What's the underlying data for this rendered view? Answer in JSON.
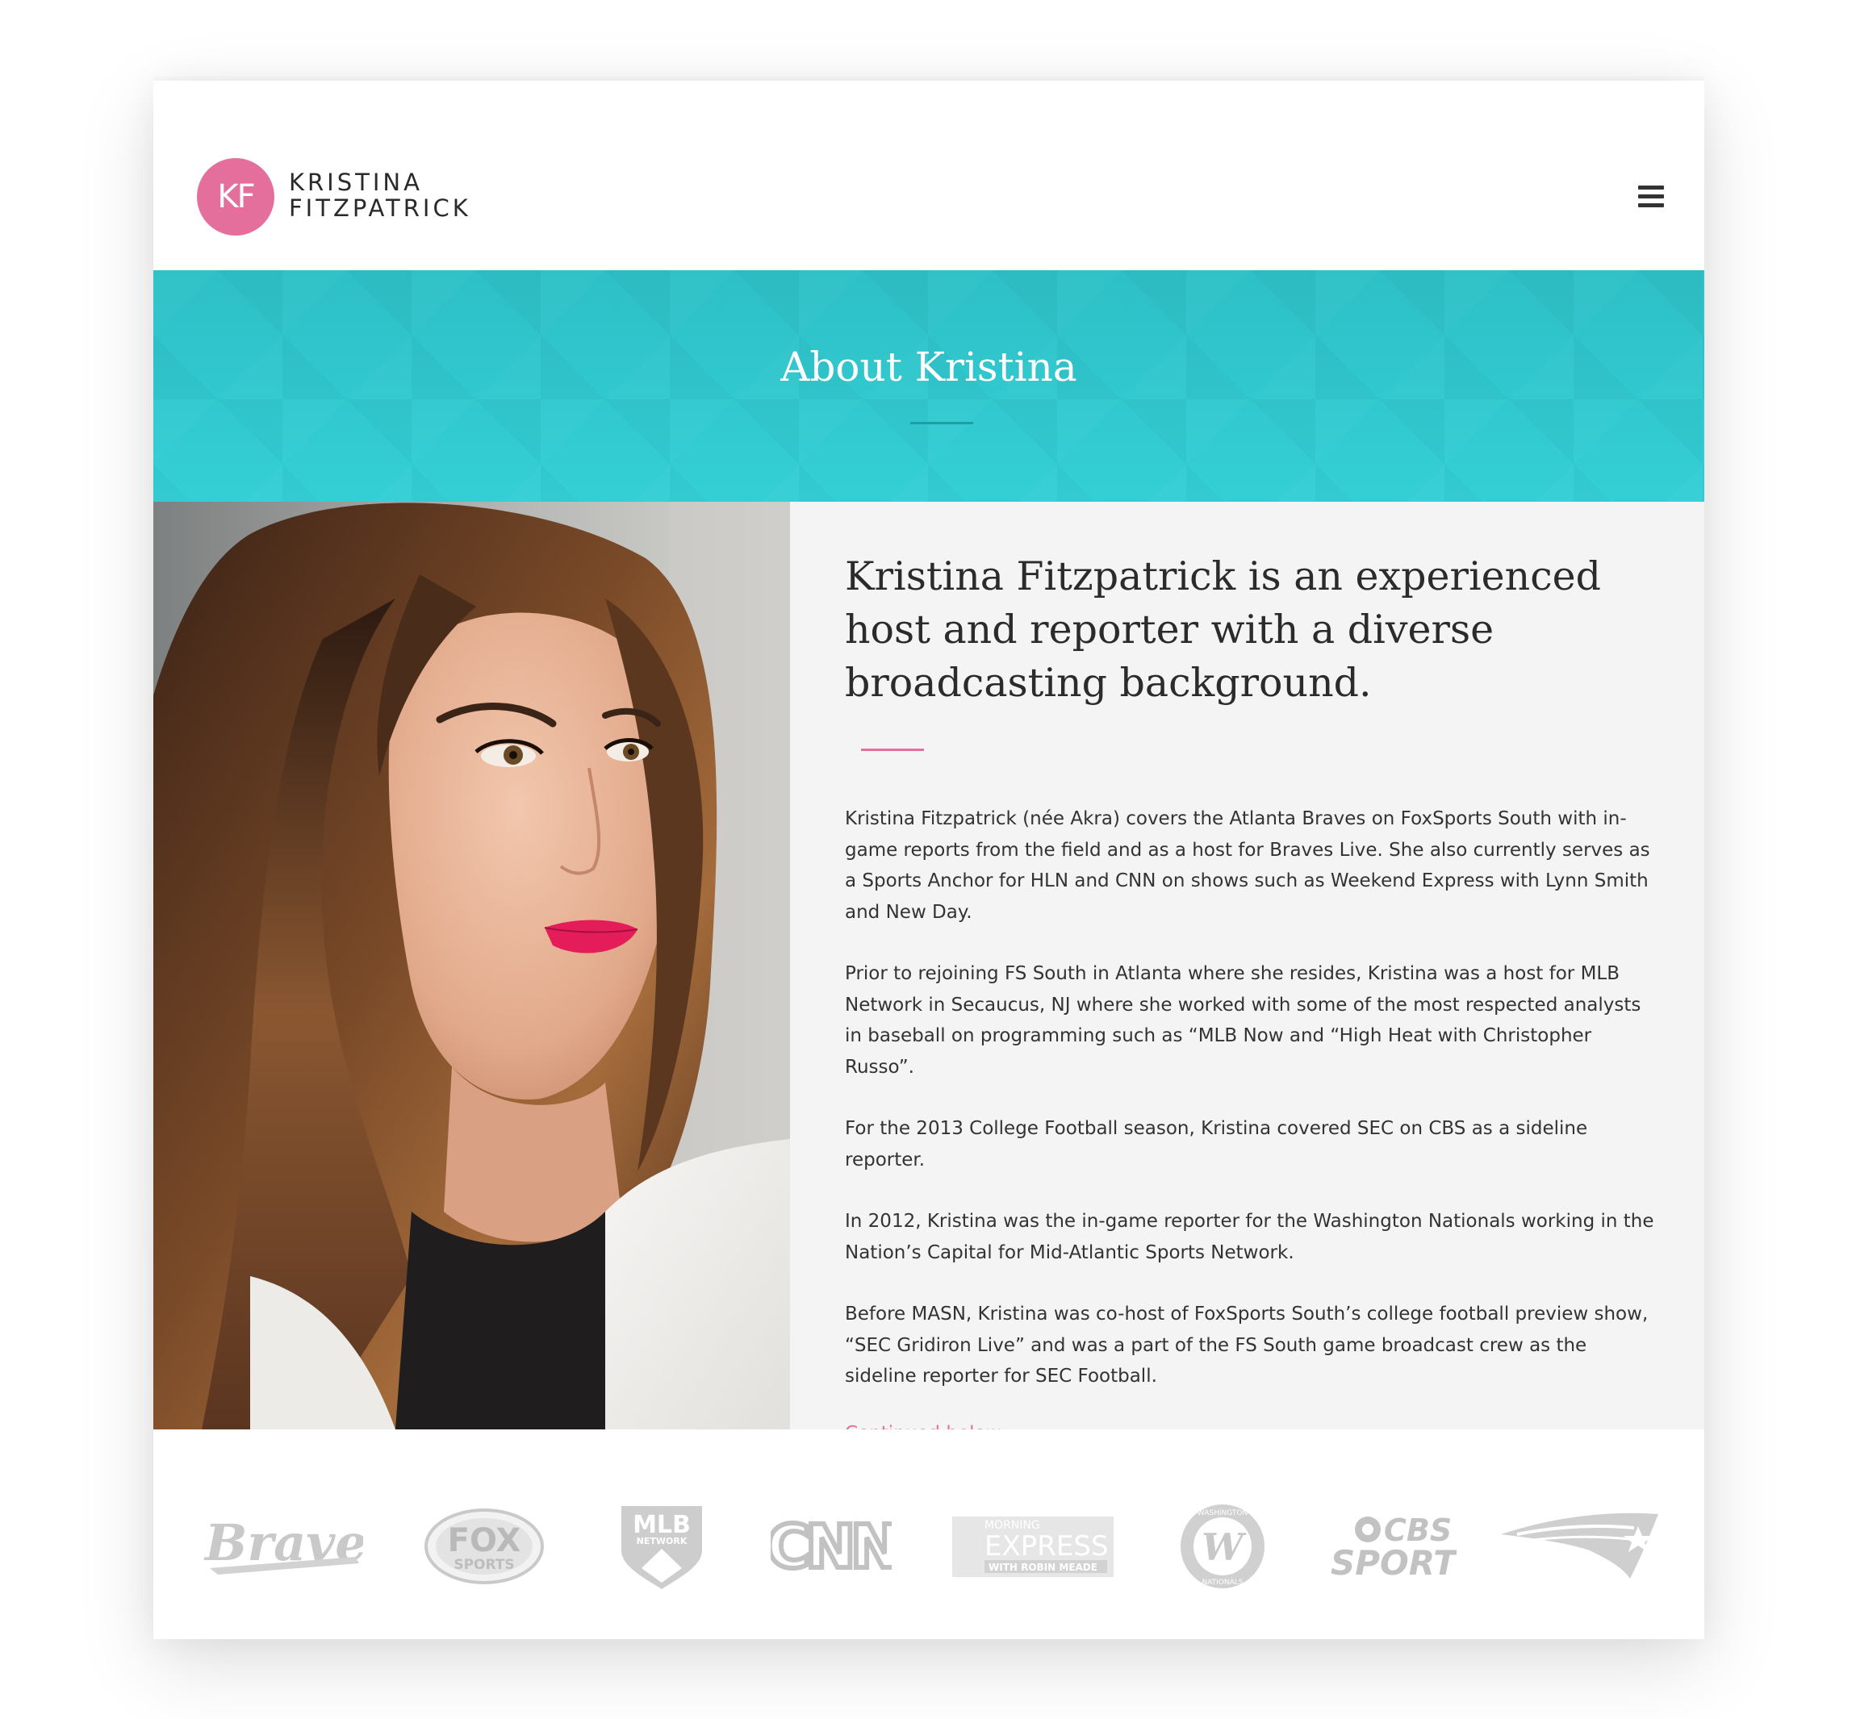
{
  "brand": {
    "monogram": "KF",
    "name_line1": "KRISTINA",
    "name_line2": "FITZPATRICK",
    "accent": "#e56f9c",
    "teal": "#2fc7cf"
  },
  "header": {
    "menu_icon": "hamburger-menu-icon"
  },
  "banner": {
    "title": "About Kristina"
  },
  "bio": {
    "heading": "Kristina Fitzpatrick is an experienced host and reporter with a diverse broadcasting background.",
    "paragraphs": [
      "Kristina Fitzpatrick (née Akra) covers the Atlanta Braves on FoxSports South with in-game reports from the field and as a host for Braves Live. She also currently serves as a Sports Anchor for HLN and CNN on shows such as Weekend Express with Lynn Smith and New Day.",
      "Prior to rejoining FS South in Atlanta where she resides, Kristina was a host for MLB Network in Secaucus, NJ where she worked with some of the most respected analysts in baseball on programming such as “MLB Now and “High Heat with Christopher Russo”.",
      "For the 2013 College Football season, Kristina covered SEC on CBS as a sideline reporter.",
      "In 2012, Kristina was the in-game reporter for the Washington Nationals working in the Nation’s Capital for Mid-Atlantic Sports Network.",
      "Before MASN, Kristina was co-host of FoxSports South’s college football preview show, “SEC Gridiron Live” and was a part of the FS South game broadcast crew as the sideline reporter for SEC Football."
    ],
    "continued_link": "Continued below ..."
  },
  "logos": {
    "braves": "Braves",
    "fox_line1": "FOX",
    "fox_line2": "SPORTS",
    "mlb_line1": "MLB",
    "mlb_line2": "NETWORK",
    "cnn": "CNN",
    "morning_express_line1": "MORNING",
    "morning_express_line2": "EXPRESS",
    "morning_express_line3": "WITH ROBIN MEADE",
    "nationals_letter": "W",
    "nationals_ring_top": "WASHINGTON",
    "nationals_ring_bottom": "NATIONALS",
    "cbs_line1": "CBS",
    "cbs_line2": "SPORTS",
    "patriots": "patriots-logo"
  }
}
